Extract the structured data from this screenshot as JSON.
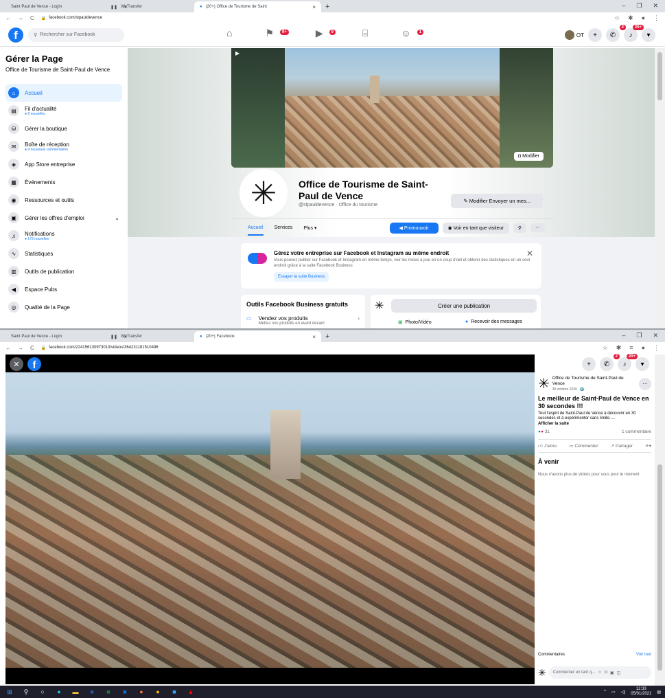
{
  "browser1": {
    "tabs": [
      {
        "label": "Saint Paul de Vence - Login",
        "active": false
      },
      {
        "label": "WeTransfer",
        "active": false
      },
      {
        "label": "(20+) Office de Tourisme de Saint",
        "active": true
      }
    ],
    "url": "facebook.com/stpauldevence"
  },
  "fb": {
    "search_placeholder": "Rechercher sur Facebook",
    "badges": {
      "flag": "9+",
      "video": "9",
      "groups": "1"
    },
    "user_initials": "OT",
    "messenger_badge": "2",
    "notif_badge": "20+"
  },
  "sidebar": {
    "title": "Gérer la Page",
    "page_name": "Office de Tourisme de Saint-Paul de Vence",
    "items": [
      {
        "label": "Accueil",
        "sub": "",
        "icon": "⌂"
      },
      {
        "label": "Fil d'actualité",
        "sub": "● 8 nouvelles",
        "icon": "▤"
      },
      {
        "label": "Gérer la boutique",
        "sub": "",
        "icon": "⛁"
      },
      {
        "label": "Boîte de réception",
        "sub": "● 9 nouveaux commentaires",
        "icon": "✉"
      },
      {
        "label": "App Store entreprise",
        "sub": "",
        "icon": "◈"
      },
      {
        "label": "Événements",
        "sub": "",
        "icon": "▦"
      },
      {
        "label": "Ressources et outils",
        "sub": "",
        "icon": "◉"
      },
      {
        "label": "Gérer les offres d'emploi",
        "sub": "",
        "icon": "▣"
      },
      {
        "label": "Notifications",
        "sub": "● 179 nouvelles",
        "icon": "♫"
      },
      {
        "label": "Statistiques",
        "sub": "",
        "icon": "∿"
      },
      {
        "label": "Outils de publication",
        "sub": "",
        "icon": "▥"
      },
      {
        "label": "Espace Pubs",
        "sub": "",
        "icon": "◀"
      },
      {
        "label": "Qualité de la Page",
        "sub": "",
        "icon": "◎"
      }
    ]
  },
  "page": {
    "cover_edit": "Modifier",
    "title": "Office de Tourisme de Saint-Paul de Vence",
    "handle": "@stpauldevence · Office du tourisme",
    "edit_button": "Modifier Envoyer un mes...",
    "tabs": [
      "Accueil",
      "Services",
      "Plus ▾"
    ],
    "promote": "Promouvoir",
    "view_as": "Voir en tant que visiteur"
  },
  "business_card": {
    "title": "Gérez votre entreprise sur Facebook et Instagram au même endroit",
    "text": "Vous pouvez publier sur Facebook et Instagram en même temps, voir les mises à jour en un coup d'œil et obtenir des statistiques en un seul endroit grâce à la suite Facebook Business",
    "button": "Essayer la suite Business"
  },
  "tools_card": {
    "title": "Outils Facebook Business gratuits",
    "item_title": "Vendez vos produits",
    "item_sub": "Mettez vos produits en avant devant"
  },
  "post_card": {
    "create": "Créer une publication",
    "photo": "Photo/Vidéo",
    "messages": "Recevoir des messages"
  },
  "browser2": {
    "tabs": [
      {
        "label": "Saint Paul de Vence - Login",
        "active": false
      },
      {
        "label": "WeTransfer",
        "active": false
      },
      {
        "label": "(20+) Facebook",
        "active": true
      }
    ],
    "url": "facebook.com/224156130973010/videos/364231181510496"
  },
  "video_panel": {
    "page_name": "Office de Tourisme de Saint-Paul de Vence",
    "date": "30 octobre 2020 · 🌍",
    "title": "Le meilleur de Saint-Paul de Vence en 30 secondes !!!",
    "description": "Tout l'esprit de Saint-Paul de Vence à découvrir en 30 secondes et à expérimenter sans limite.....",
    "see_more": "Afficher la suite",
    "reactions": "31",
    "comments_count": "1 commentaire",
    "like": "J'aime",
    "comment": "Commenter",
    "share": "Partager",
    "upcoming": "À venir",
    "no_more": "Nous n'avons plus de vidéos pour vous pour le moment",
    "comments_label": "Commentaires",
    "see_all": "Voir tout",
    "comment_placeholder": "Commenter en tant q..."
  },
  "taskbar": {
    "time": "12:33",
    "date": "05/01/2021"
  }
}
